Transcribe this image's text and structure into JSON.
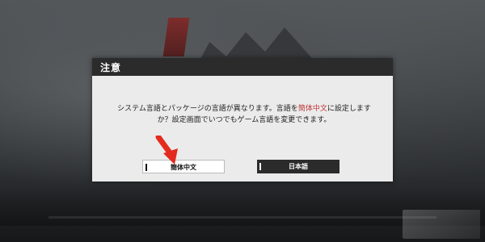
{
  "dialog": {
    "title": "注意",
    "message_parts": [
      "システム言語とパッケージの言語が異なります。言語を",
      "簡体中文",
      "に設定しますか？設定画面でいつでもゲーム言語を変更できます。"
    ],
    "accent_color": "#c0393b"
  },
  "buttons": {
    "simplified_chinese": "簡体中文",
    "japanese": "日本語"
  },
  "overlay": {
    "arrow_icon": "red-down-arrow",
    "arrow_color": "#e32b1f"
  }
}
